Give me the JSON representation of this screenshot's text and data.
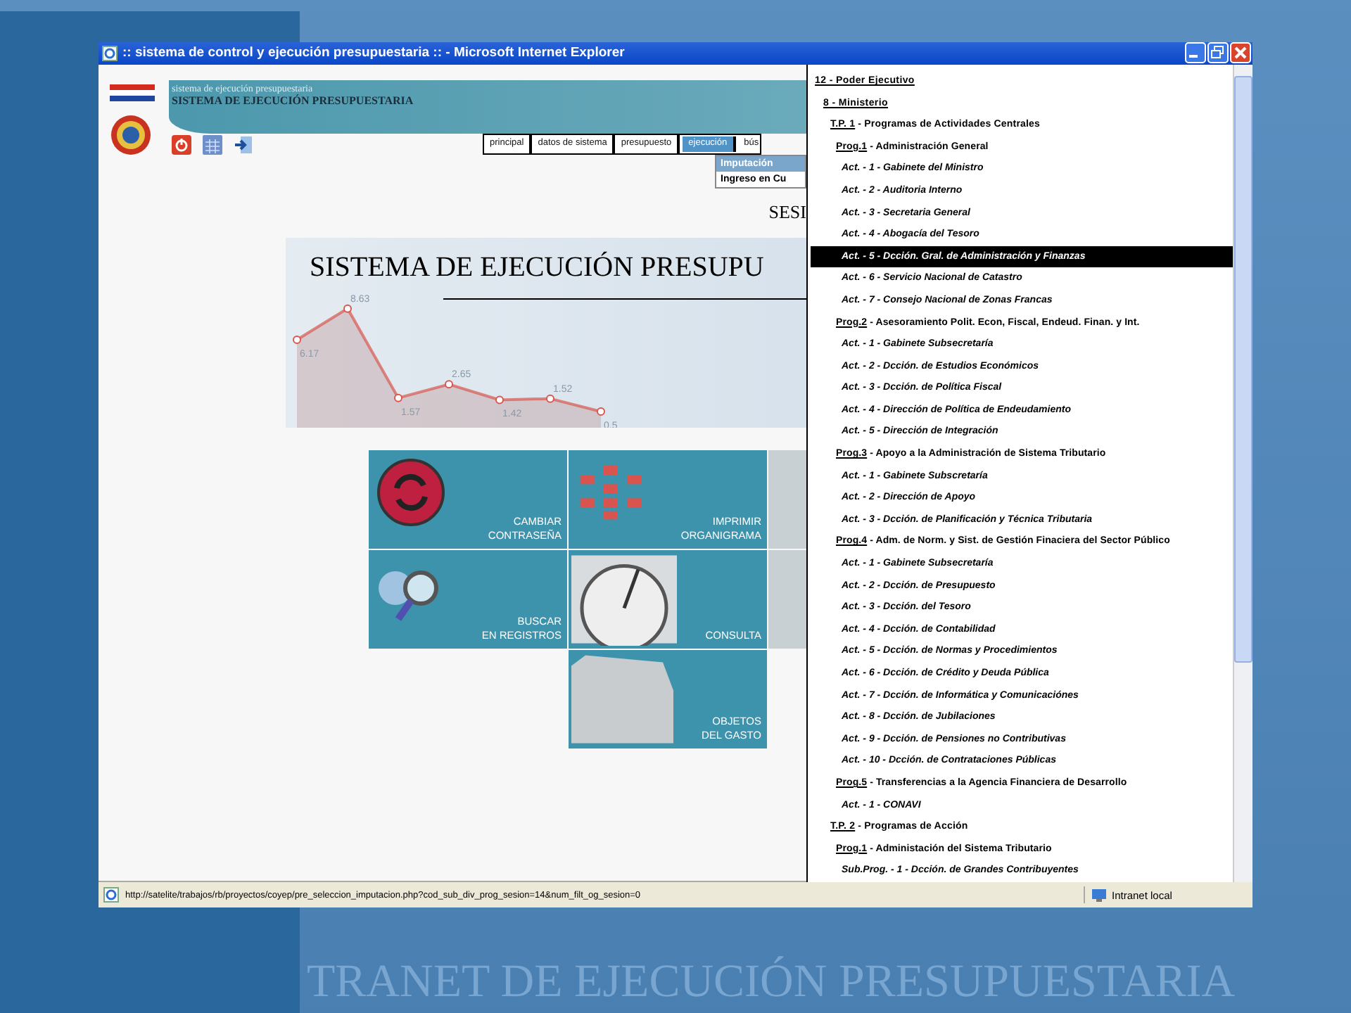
{
  "window": {
    "title": ":: sistema de control y ejecución presupuestaria :: - Microsoft Internet Explorer"
  },
  "header": {
    "subtitle": "sistema de ejecución presupuestaria",
    "title": "SISTEMA DE EJECUCIÓN PRESUPUESTARIA"
  },
  "nav": [
    {
      "label": "principal",
      "selected": false
    },
    {
      "label": "datos de sistema",
      "selected": false
    },
    {
      "label": "presupuesto",
      "selected": false
    },
    {
      "label": "ejecución",
      "selected": true
    },
    {
      "label": "bús",
      "selected": false
    }
  ],
  "dropdown": [
    {
      "label": "Imputación",
      "selected": true
    },
    {
      "label": "Ingreso en Cu",
      "selected": false
    }
  ],
  "session_text": "SESI",
  "banner": {
    "title": "SISTEMA DE EJECUCIÓN PRESUPU",
    "chart_data": {
      "type": "area",
      "series": [
        {
          "color": "#d9574f",
          "marker": "o",
          "values": [
            6.17,
            8.63,
            1.57,
            2.65,
            1.42,
            1.52,
            0.5
          ]
        }
      ],
      "data_labels": true
    }
  },
  "tiles": [
    [
      {
        "kind": "refresh",
        "lines": [
          "CAMBIAR",
          "CONTRASEÑA"
        ]
      },
      {
        "kind": "orgchart",
        "lines": [
          "IMPRIMIR",
          "ORGANIGRAMA"
        ]
      },
      {
        "kind": "photo"
      }
    ],
    [
      {
        "kind": "search",
        "lines": [
          "BUSCAR",
          "EN REGISTROS"
        ]
      },
      {
        "kind": "stopwatch",
        "lines": [
          "CONSULTA"
        ]
      },
      {
        "kind": "photo"
      }
    ],
    [
      {
        "kind": "document",
        "lines": [
          "OBJETOS",
          "DEL GASTO"
        ]
      }
    ]
  ],
  "tree": [
    {
      "kind": "root",
      "code": "12 - Poder Ejecutivo",
      "selected": false,
      "children": [
        {
          "kind": "root",
          "code": "8 - Ministerio",
          "selected": false,
          "children": [
            {
              "kind": "tp",
              "code": "T.P. 1",
              "label": "- Programas de Actividades Centrales",
              "selected": false,
              "children": [
                {
                  "kind": "prog",
                  "code": "Prog.1",
                  "label": "- Administración General",
                  "selected": false,
                  "children": [
                    {
                      "kind": "act",
                      "label": "Act. - 1 - Gabinete del Ministro",
                      "selected": false
                    },
                    {
                      "kind": "act",
                      "label": "Act. - 2 - Auditoria Interno",
                      "selected": false
                    },
                    {
                      "kind": "act",
                      "label": "Act. - 3 - Secretaria General",
                      "selected": false
                    },
                    {
                      "kind": "act",
                      "label": "Act. - 4 - Abogacía del Tesoro",
                      "selected": false
                    },
                    {
                      "kind": "act",
                      "label": "Act. - 5 - Dcción. Gral. de Administración y Finanzas",
                      "selected": true
                    },
                    {
                      "kind": "act",
                      "label": "Act. - 6 - Servicio Nacional de Catastro",
                      "selected": false
                    },
                    {
                      "kind": "act",
                      "label": "Act. - 7 - Consejo Nacional de Zonas Francas",
                      "selected": false
                    }
                  ]
                },
                {
                  "kind": "prog",
                  "code": "Prog.2",
                  "label": "- Asesoramiento Polit. Econ, Fiscal, Endeud. Finan. y Int.",
                  "selected": false,
                  "children": [
                    {
                      "kind": "act",
                      "label": "Act. - 1 - Gabinete Subsecretaría",
                      "selected": false
                    },
                    {
                      "kind": "act",
                      "label": "Act. - 2 - Dcción. de Estudios Económicos",
                      "selected": false
                    },
                    {
                      "kind": "act",
                      "label": "Act. - 3 - Dcción. de Política Fiscal",
                      "selected": false
                    },
                    {
                      "kind": "act",
                      "label": "Act. - 4 - Dirección de Política de Endeudamiento",
                      "selected": false
                    },
                    {
                      "kind": "act",
                      "label": "Act. - 5 - Dirección de Integración",
                      "selected": false
                    }
                  ]
                },
                {
                  "kind": "prog",
                  "code": "Prog.3",
                  "label": "- Apoyo a la Administración de Sistema Tributario",
                  "selected": false,
                  "children": [
                    {
                      "kind": "act",
                      "label": "Act. - 1 - Gabinete Subscretaría",
                      "selected": false
                    },
                    {
                      "kind": "act",
                      "label": "Act. - 2 - Dirección de Apoyo",
                      "selected": false
                    },
                    {
                      "kind": "act",
                      "label": "Act. - 3 - Dcción. de Planificación y Técnica Tributaria",
                      "selected": false
                    }
                  ]
                },
                {
                  "kind": "prog",
                  "code": "Prog.4",
                  "label": "- Adm. de Norm. y Sist. de Gestión Finaciera del Sector Público",
                  "selected": false,
                  "children": [
                    {
                      "kind": "act",
                      "label": "Act. - 1 - Gabinete Subsecretaría",
                      "selected": false
                    },
                    {
                      "kind": "act",
                      "label": "Act. - 2 - Dcción. de Presupuesto",
                      "selected": false
                    },
                    {
                      "kind": "act",
                      "label": "Act. - 3 - Dcción. del Tesoro",
                      "selected": false
                    },
                    {
                      "kind": "act",
                      "label": "Act. - 4 - Dcción. de Contabilidad",
                      "selected": false
                    },
                    {
                      "kind": "act",
                      "label": "Act. - 5 - Dcción. de Normas y Procedimientos",
                      "selected": false
                    },
                    {
                      "kind": "act",
                      "label": "Act. - 6 - Dcción. de Crédito y Deuda Pública",
                      "selected": false
                    },
                    {
                      "kind": "act",
                      "label": "Act. - 7 - Dcción. de Informática y Comunicaciónes",
                      "selected": false
                    },
                    {
                      "kind": "act",
                      "label": "Act. - 8 - Dcción. de Jubilaciones",
                      "selected": false
                    },
                    {
                      "kind": "act",
                      "label": "Act. - 9 - Dcción. de Pensiones no Contributivas",
                      "selected": false
                    },
                    {
                      "kind": "act",
                      "label": "Act. - 10 - Dcción. de Contrataciones Públicas",
                      "selected": false
                    }
                  ]
                },
                {
                  "kind": "prog",
                  "code": "Prog.5",
                  "label": "- Transferencias a la Agencia Financiera de Desarrollo",
                  "selected": false,
                  "children": [
                    {
                      "kind": "act",
                      "label": "Act. - 1 - CONAVI",
                      "selected": false
                    }
                  ]
                }
              ]
            },
            {
              "kind": "tp",
              "code": "T.P. 2",
              "label": "- Programas de Acción",
              "selected": false,
              "children": [
                {
                  "kind": "prog",
                  "code": "Prog.1",
                  "label": "- Administación del Sistema Tributario",
                  "selected": false,
                  "children": [
                    {
                      "kind": "act",
                      "label": "Sub.Prog. - 1 - Dcción. de Grandes Contribuyentes",
                      "selected": false
                    }
                  ]
                }
              ]
            }
          ]
        }
      ]
    }
  ],
  "status_bar": {
    "url": "http://satelite/trabajos/rb/proyectos/coyep/pre_seleccion_imputacion.php?cod_sub_div_prog_sesion=14&num_filt_og_sesion=0",
    "zone": "Intranet local"
  },
  "slide": {
    "footer": "TRANET DE EJECUCIÓN PRESUPUESTARIA"
  }
}
